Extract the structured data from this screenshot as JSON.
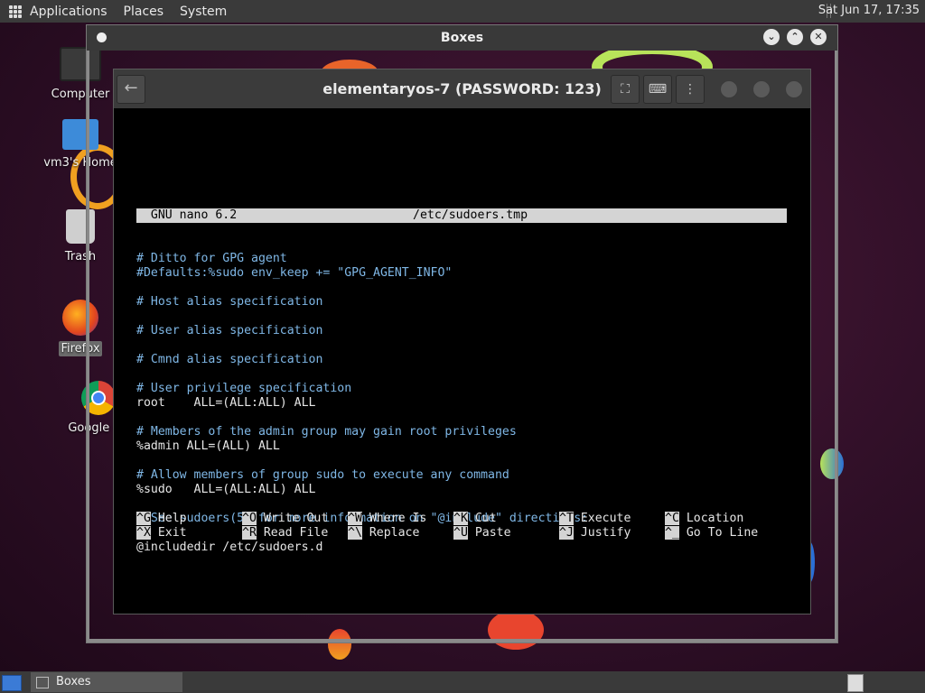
{
  "top_panel": {
    "menus": [
      "Applications",
      "Places",
      "System"
    ],
    "clock": "Sat Jun 17, 17:35"
  },
  "desktop": {
    "icons": [
      {
        "label": "Computer",
        "icon": "computer-icon"
      },
      {
        "label": "vm3's Home",
        "icon": "home-folder-icon"
      },
      {
        "label": "Trash",
        "icon": "trash-icon"
      },
      {
        "label": "Firefox",
        "icon": "firefox-icon"
      },
      {
        "label": "Google Ch",
        "icon": "chrome-icon"
      }
    ]
  },
  "boxes_window": {
    "title": "Boxes",
    "buttons": [
      "minimize",
      "maximize",
      "close"
    ]
  },
  "guest_window": {
    "title": "elementaryos-7 (PASSWORD: 123)",
    "header_buttons": [
      "fullscreen-icon",
      "keyboard-icon",
      "menu-icon"
    ]
  },
  "nano": {
    "status_left": "  GNU nano 6.2",
    "status_file": "/etc/sudoers.tmp",
    "lines": [
      {
        "text": "# Ditto for GPG agent",
        "comment": true
      },
      {
        "text": "#Defaults:%sudo env_keep += \"GPG_AGENT_INFO\"",
        "comment": true
      },
      {
        "text": "",
        "comment": false
      },
      {
        "text": "# Host alias specification",
        "comment": true
      },
      {
        "text": "",
        "comment": false
      },
      {
        "text": "# User alias specification",
        "comment": true
      },
      {
        "text": "",
        "comment": false
      },
      {
        "text": "# Cmnd alias specification",
        "comment": true
      },
      {
        "text": "",
        "comment": false
      },
      {
        "text": "# User privilege specification",
        "comment": true
      },
      {
        "text": "root    ALL=(ALL:ALL) ALL",
        "comment": false
      },
      {
        "text": "",
        "comment": false
      },
      {
        "text": "# Members of the admin group may gain root privileges",
        "comment": true
      },
      {
        "text": "%admin ALL=(ALL) ALL",
        "comment": false
      },
      {
        "text": "",
        "comment": false
      },
      {
        "text": "# Allow members of group sudo to execute any command",
        "comment": true
      },
      {
        "text": "%sudo   ALL=(ALL:ALL) ALL",
        "comment": false
      },
      {
        "text": "",
        "comment": false
      },
      {
        "text": "# See sudoers(5) for more information on \"@include\" directives:",
        "comment": true
      },
      {
        "text": "",
        "comment": false
      },
      {
        "text": "@includedir /etc/sudoers.d",
        "comment": false
      }
    ],
    "shortcuts_row1": [
      {
        "key": "^G",
        "label": "Help"
      },
      {
        "key": "^O",
        "label": "Write Out"
      },
      {
        "key": "^W",
        "label": "Where Is"
      },
      {
        "key": "^K",
        "label": "Cut"
      },
      {
        "key": "^T",
        "label": "Execute"
      },
      {
        "key": "^C",
        "label": "Location"
      }
    ],
    "shortcuts_row2": [
      {
        "key": "^X",
        "label": "Exit"
      },
      {
        "key": "^R",
        "label": "Read File"
      },
      {
        "key": "^\\",
        "label": "Replace"
      },
      {
        "key": "^U",
        "label": "Paste"
      },
      {
        "key": "^J",
        "label": "Justify"
      },
      {
        "key": "^_",
        "label": "Go To Line"
      }
    ]
  },
  "taskbar": {
    "task_label": "Boxes"
  }
}
